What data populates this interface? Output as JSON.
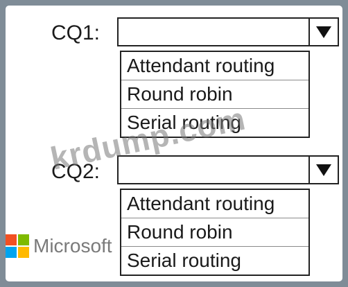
{
  "questions": [
    {
      "label": "CQ1:",
      "selected_value": "",
      "options": [
        "Attendant routing",
        "Round robin",
        "Serial routing"
      ]
    },
    {
      "label": "CQ2:",
      "selected_value": "",
      "options": [
        "Attendant routing",
        "Round robin",
        "Serial routing"
      ]
    }
  ],
  "watermark": "krdump.com",
  "brand": {
    "name": "Microsoft",
    "colors": [
      "#f25022",
      "#7fba00",
      "#00a4ef",
      "#ffb900"
    ]
  }
}
